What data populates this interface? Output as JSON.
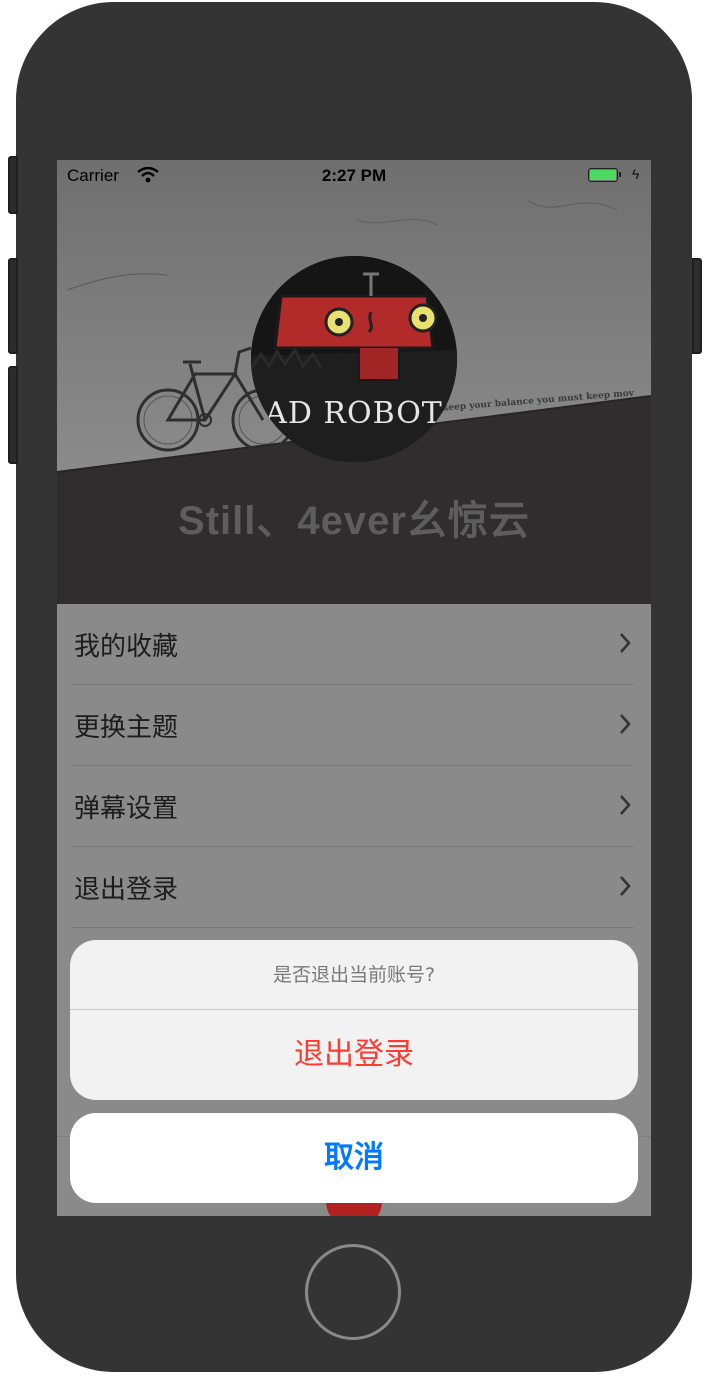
{
  "status_bar": {
    "carrier": "Carrier",
    "time": "2:27 PM",
    "wifi_icon": "wifi-icon",
    "battery_icon": "battery-icon",
    "battery_level": 1.0,
    "battery_color": "#4cd964"
  },
  "profile": {
    "username": "Still、4ever幺惊云",
    "avatar_caption": "AD ROBOT",
    "background_quote": "ic. To keep your balance you must keep mov"
  },
  "menu": {
    "items": [
      {
        "label": "我的收藏"
      },
      {
        "label": "更换主题"
      },
      {
        "label": "弹幕设置"
      },
      {
        "label": "退出登录"
      }
    ],
    "chevron_icon": "chevron-right-icon"
  },
  "action_sheet": {
    "title": "是否退出当前账号?",
    "destructive_label": "退出登录",
    "cancel_label": "取消"
  },
  "colors": {
    "destructive": "#ff3b30",
    "cancel": "#007aff",
    "tab_center": "#b22020"
  }
}
